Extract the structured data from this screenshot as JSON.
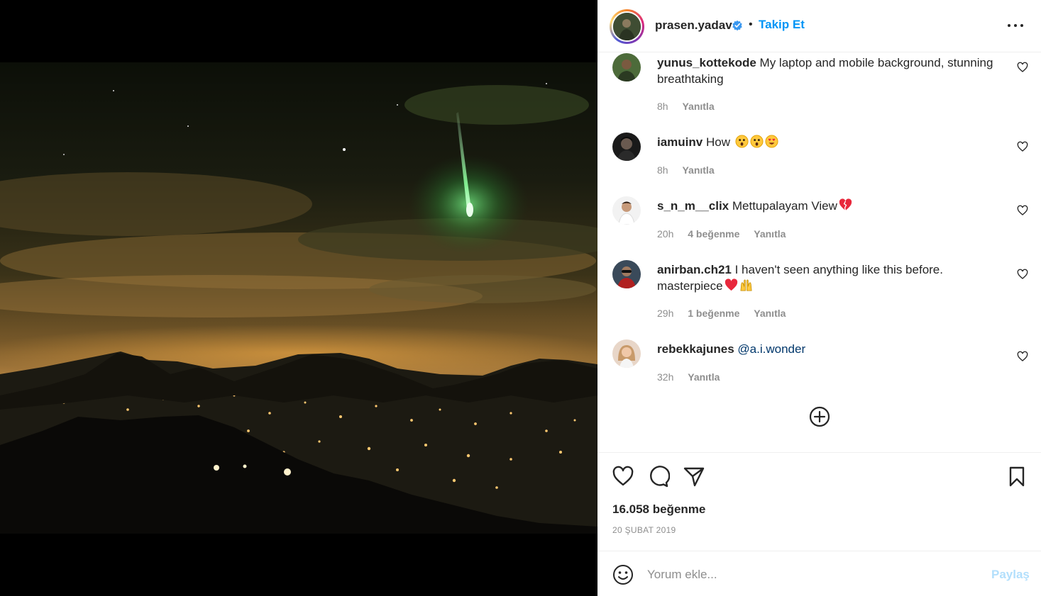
{
  "post": {
    "owner": "prasen.yadav",
    "verified": true,
    "separator": "•",
    "follow_label": "Takip Et",
    "image_alt": "Night sky with green meteor over illuminated hills"
  },
  "comments": [
    {
      "user": "yunus_kottekode",
      "text": "My laptop and mobile background, stunning breathtaking",
      "time": "8h",
      "likes": "",
      "reply": "Yanıtla"
    },
    {
      "user": "iamuinv",
      "text": "How",
      "emojis": [
        "astonished-face",
        "astonished-face",
        "heart-eyes-face"
      ],
      "time": "8h",
      "likes": "",
      "reply": "Yanıtla"
    },
    {
      "user": "s_n_m__clix",
      "text": "Mettupalayam View",
      "emojis": [
        "broken-heart"
      ],
      "time": "20h",
      "likes": "4 beğenme",
      "reply": "Yanıtla"
    },
    {
      "user": "anirban.ch21",
      "text": "I haven't seen anything like this before. masterpiece",
      "emojis": [
        "red-heart",
        "raising-hands"
      ],
      "time": "29h",
      "likes": "1 beğenme",
      "reply": "Yanıtla"
    },
    {
      "user": "rebekkajunes",
      "text": "@a.i.wonder",
      "time": "32h",
      "likes": "",
      "reply": "Yanıtla"
    }
  ],
  "stats": {
    "likes": "16.058 beğenme",
    "date": "20 ŞUBAT 2019"
  },
  "composer": {
    "placeholder": "Yorum ekle...",
    "post_label": "Paylaş"
  },
  "colors": {
    "link": "#0095f6",
    "muted": "#8e8e8e",
    "text": "#262626",
    "post_disabled": "#b2dffc",
    "meteor": "#5dff7a"
  }
}
